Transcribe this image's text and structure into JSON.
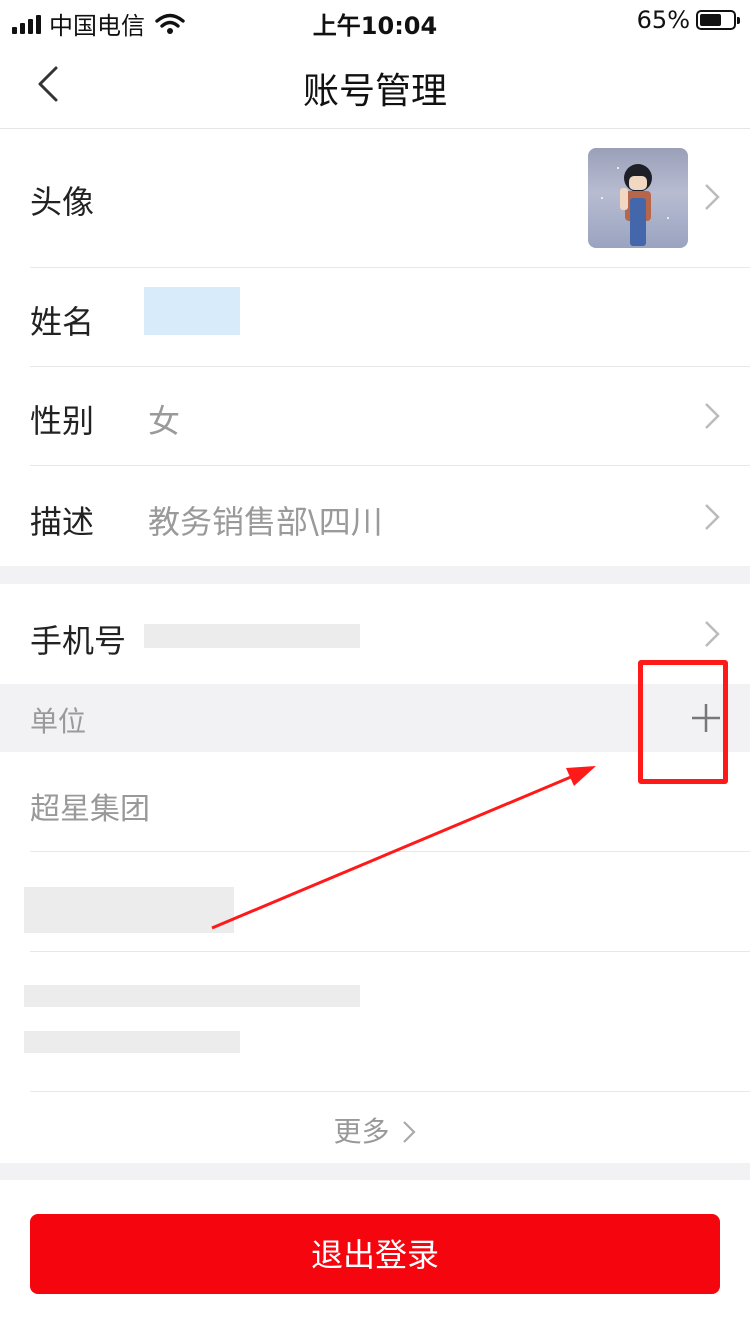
{
  "status_bar": {
    "carrier": "中国电信",
    "time": "上午10:04",
    "battery": "65%",
    "battery_level": 0.65
  },
  "nav": {
    "title": "账号管理",
    "back_icon": "chevron-left-icon"
  },
  "profile": {
    "avatar_label": "头像",
    "name_label": "姓名",
    "gender_label": "性别",
    "gender_value": "女",
    "desc_label": "描述",
    "desc_value": "教务销售部\\四川"
  },
  "phone": {
    "label": "手机号"
  },
  "units": {
    "header": "单位",
    "add_icon": "plus-icon",
    "items": [
      "超星集团"
    ],
    "more_label": "更多"
  },
  "logout_label": "退出登录",
  "colors": {
    "accent": "#f5060e",
    "annotation": "#ff1a1a"
  }
}
